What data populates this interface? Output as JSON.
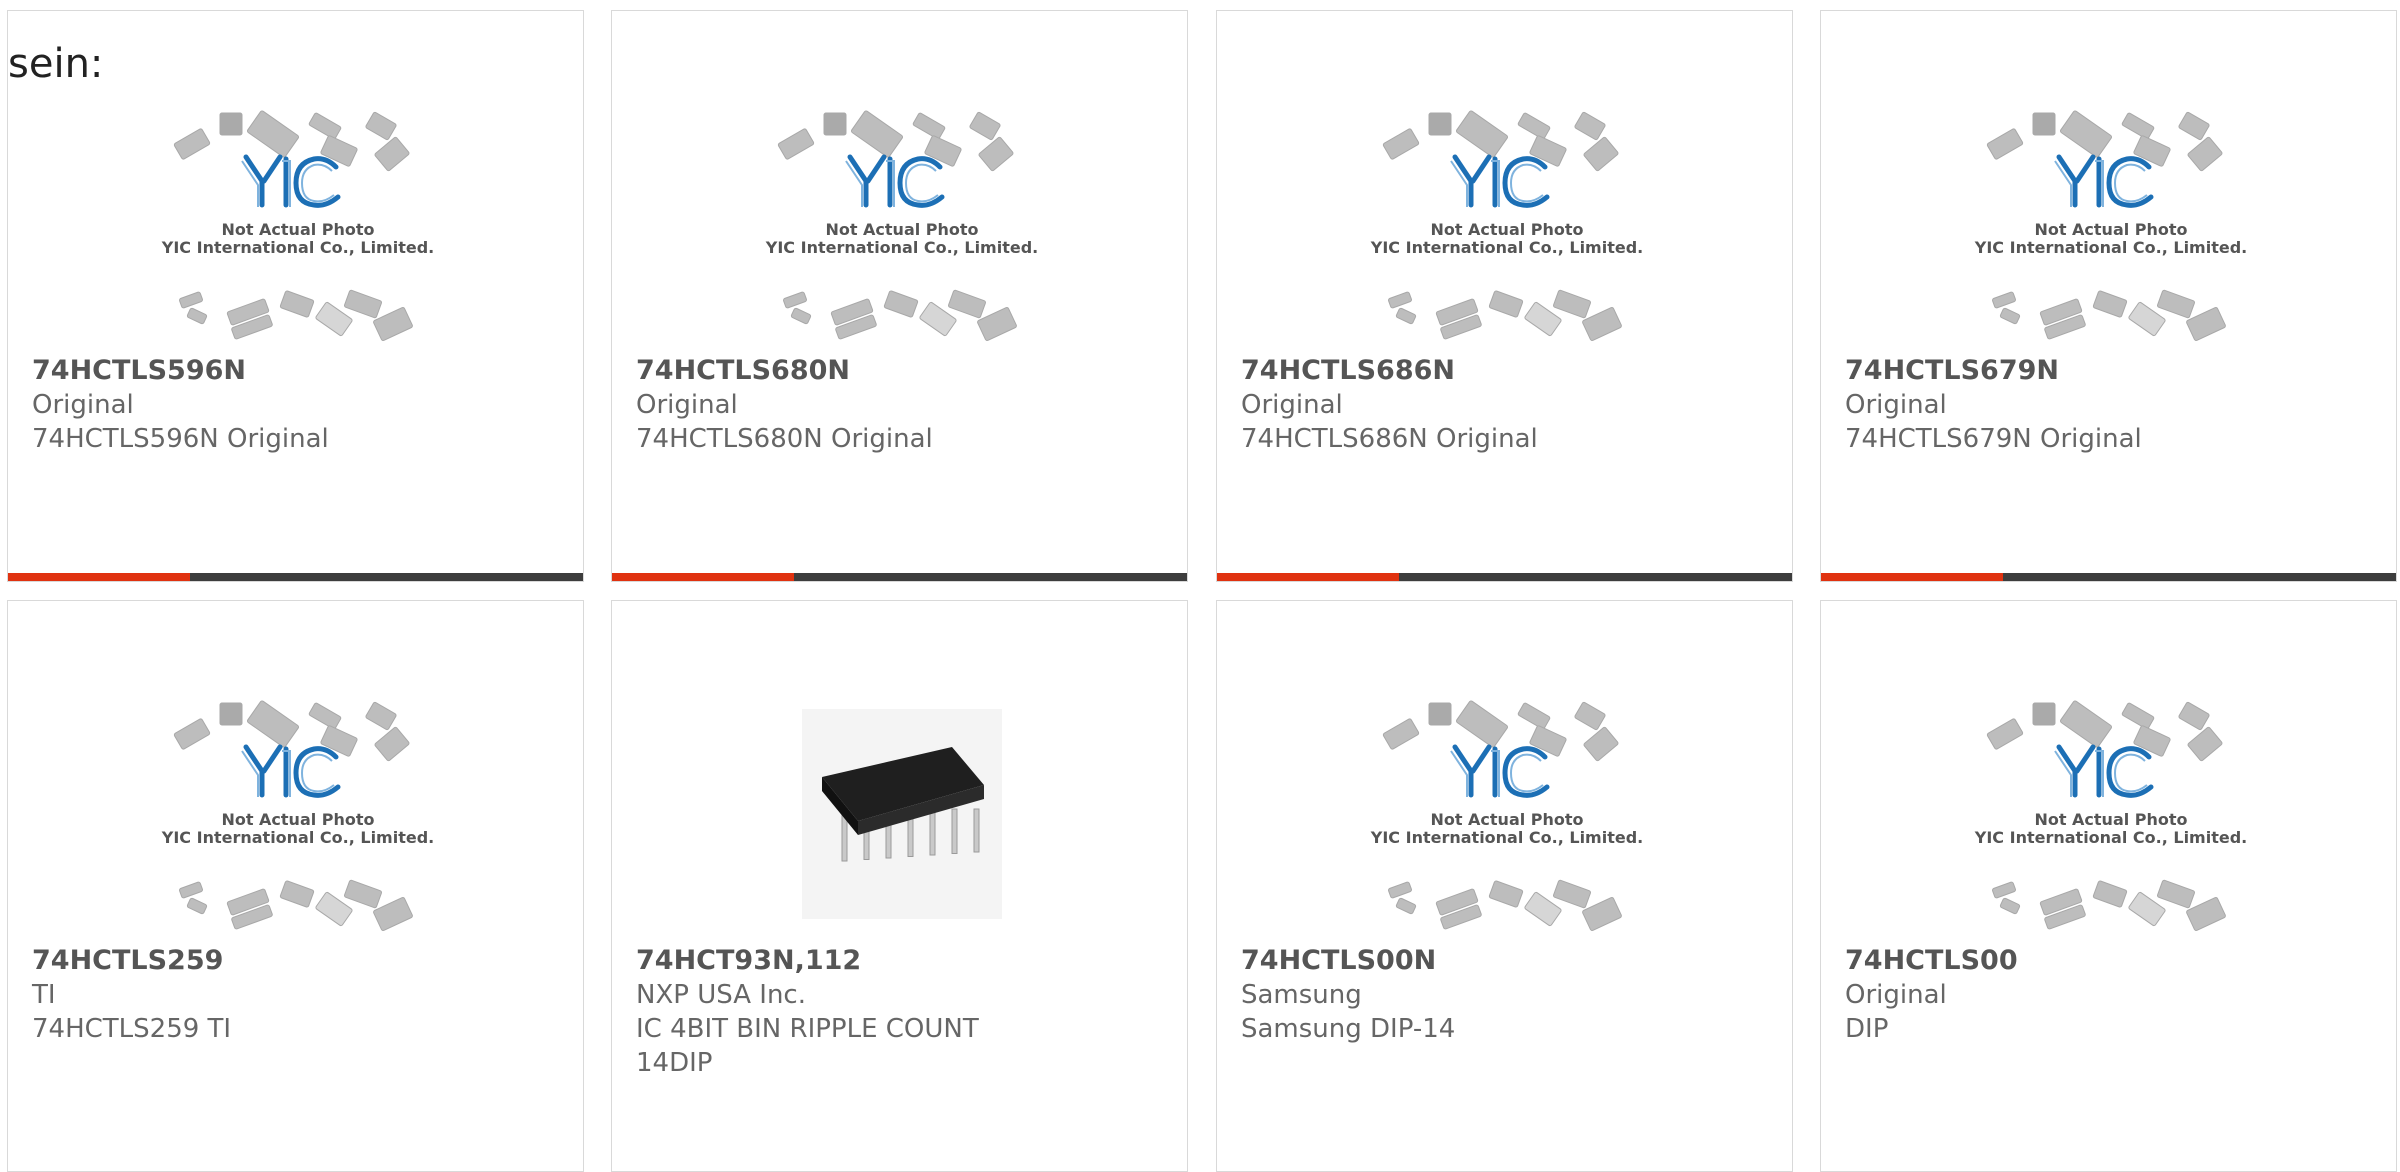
{
  "lead_text": "sein:",
  "placeholder_image": {
    "line1": "Not Actual Photo",
    "line2": "YIC International Co., Limited."
  },
  "colors": {
    "accent": "#e03210",
    "bar": "#3d3d3d",
    "logo_blue": "#1c6fb5",
    "text": "#666666"
  },
  "products": [
    {
      "name": "74HCTLS596N",
      "line1": "Original",
      "line2": "74HCTLS596N Original",
      "line3": "",
      "image": "yic-placeholder",
      "accent_bar": true
    },
    {
      "name": "74HCTLS680N",
      "line1": "Original",
      "line2": "74HCTLS680N Original",
      "line3": "",
      "image": "yic-placeholder",
      "accent_bar": true
    },
    {
      "name": "74HCTLS686N",
      "line1": "Original",
      "line2": "74HCTLS686N Original",
      "line3": "",
      "image": "yic-placeholder",
      "accent_bar": true
    },
    {
      "name": "74HCTLS679N",
      "line1": "Original",
      "line2": "74HCTLS679N Original",
      "line3": "",
      "image": "yic-placeholder",
      "accent_bar": true
    },
    {
      "name": "74HCTLS259",
      "line1": "TI",
      "line2": "74HCTLS259 TI",
      "line3": "",
      "image": "yic-placeholder",
      "accent_bar": false
    },
    {
      "name": "74HCT93N,112",
      "line1": "NXP USA Inc.",
      "line2": "IC 4BIT BIN RIPPLE COUNT",
      "line3": "14DIP",
      "image": "dip-chip-photo",
      "accent_bar": false
    },
    {
      "name": "74HCTLS00N",
      "line1": "Samsung",
      "line2": "Samsung DIP-14",
      "line3": "",
      "image": "yic-placeholder",
      "accent_bar": false
    },
    {
      "name": "74HCTLS00",
      "line1": "Original",
      "line2": "DIP",
      "line3": "",
      "image": "yic-placeholder",
      "accent_bar": false
    }
  ]
}
